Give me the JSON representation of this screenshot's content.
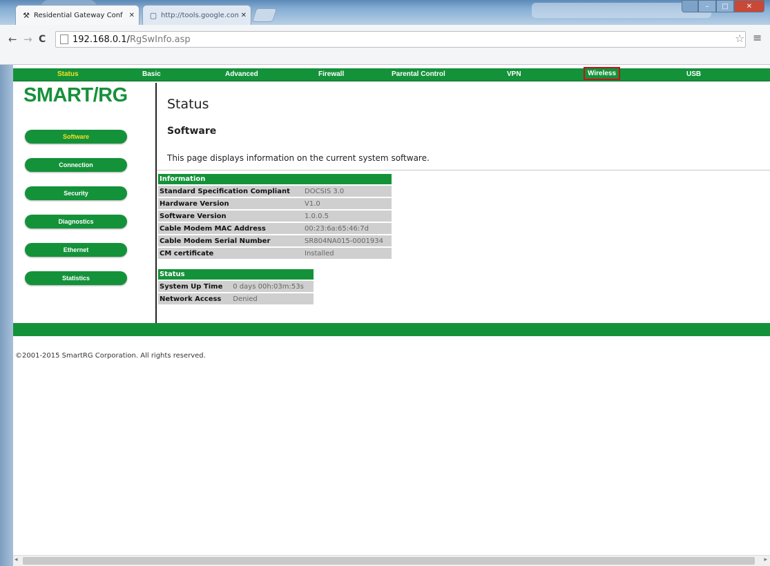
{
  "browser": {
    "tabs": [
      {
        "label": "Residential Gateway Conf",
        "icon": "tools-icon",
        "active": true
      },
      {
        "label": "http://tools.google.com/",
        "icon": "page-icon",
        "active": false
      }
    ],
    "url_host": "192.168.0.1/",
    "url_path": "RgSwInfo.asp"
  },
  "topnav": {
    "items": [
      {
        "label": "Status"
      },
      {
        "label": "Basic"
      },
      {
        "label": "Advanced"
      },
      {
        "label": "Firewall"
      },
      {
        "label": "Parental Control"
      },
      {
        "label": "VPN"
      },
      {
        "label": "Wireless"
      },
      {
        "label": "USB"
      }
    ],
    "current": "Status",
    "highlighted": "Wireless"
  },
  "logo": "SMART/RG",
  "sidebar": {
    "items": [
      {
        "label": "Software"
      },
      {
        "label": "Connection"
      },
      {
        "label": "Security"
      },
      {
        "label": "Diagnostics"
      },
      {
        "label": "Ethernet"
      },
      {
        "label": "Statistics"
      }
    ],
    "current": "Software"
  },
  "main": {
    "title": "Status",
    "section": "Software",
    "description": "This page displays information on the current system software."
  },
  "info_table": {
    "header": "Information",
    "rows": [
      {
        "key": "Standard Specification Compliant",
        "value": "DOCSIS 3.0"
      },
      {
        "key": "Hardware Version",
        "value": "V1.0"
      },
      {
        "key": "Software Version",
        "value": "1.0.0.5"
      },
      {
        "key": "Cable Modem MAC Address",
        "value": "00:23:6a:65:46:7d"
      },
      {
        "key": "Cable Modem Serial Number",
        "value": "SR804NA015-0001934"
      },
      {
        "key": "CM certificate",
        "value": "Installed"
      }
    ]
  },
  "status_table": {
    "header": "Status",
    "rows": [
      {
        "key": "System Up Time",
        "value": "0 days 00h:03m:53s"
      },
      {
        "key": "Network Access",
        "value": "Denied"
      }
    ]
  },
  "footer": {
    "copyright": "©2001-2015 SmartRG Corporation. All rights reserved."
  },
  "colors": {
    "brand_green": "#14923a",
    "current_yellow": "#f4e21f",
    "highlight_red": "#c6111a"
  }
}
